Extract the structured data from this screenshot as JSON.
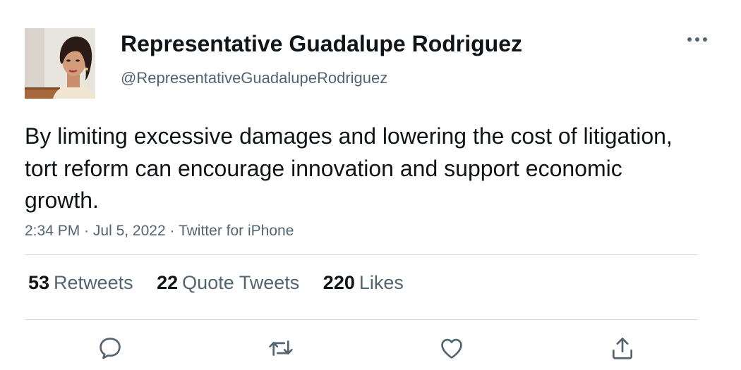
{
  "tweet": {
    "author": {
      "display_name": "Representative Guadalupe Rodriguez",
      "handle": "@RepresentativeGuadalupeRodriguez"
    },
    "text": "By limiting excessive damages and lowering the cost of litigation, tort reform can encourage innovation and support economic growth.",
    "time": "2:34 PM",
    "date": "Jul 5, 2022",
    "source": "Twitter for iPhone",
    "separator": "·",
    "stats": {
      "retweets": {
        "count": "53",
        "label": "Retweets"
      },
      "quote_tweets": {
        "count": "22",
        "label": "Quote Tweets"
      },
      "likes": {
        "count": "220",
        "label": "Likes"
      }
    },
    "actions": [
      "reply-icon",
      "retweet-icon",
      "like-icon",
      "share-icon"
    ]
  },
  "colors": {
    "text_primary": "#0f1419",
    "text_secondary": "#536471",
    "divider": "#cfd9de"
  }
}
